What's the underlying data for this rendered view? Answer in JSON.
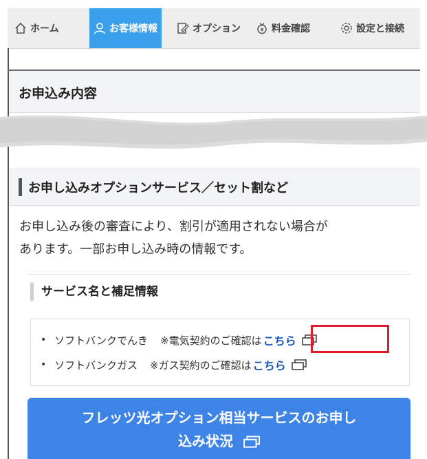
{
  "nav": {
    "items": [
      {
        "label": "ホーム",
        "icon": "home-icon",
        "active": false
      },
      {
        "label": "お客様情報",
        "icon": "user-icon",
        "active": true
      },
      {
        "label": "オプション",
        "icon": "edit-icon",
        "active": false
      },
      {
        "label": "料金確認",
        "icon": "coin-bag-icon",
        "active": false
      },
      {
        "label": "設定と接続",
        "icon": "gear-icon",
        "active": false
      }
    ],
    "active_color": "#3aa0ec"
  },
  "section": {
    "title": "お申込み内容"
  },
  "option_section": {
    "title": "お申し込みオプションサービス／セット割など",
    "note_line1": "お申し込み後の審査により、割引が適用されない場合が",
    "note_line2": "あります。一部お申し込み時の情報です。",
    "services_heading": "サービス名と補足情報",
    "services": [
      {
        "name": "ソフトバンクでんき",
        "note": "※電気契約のご確認は",
        "link": "こちら",
        "external_icon": "external-window-icon"
      },
      {
        "name": "ソフトバンクガス",
        "note": "※ガス契約のご確認は",
        "link": "こちら",
        "external_icon": "external-window-icon"
      }
    ],
    "cta_line1": "フレッツ光オプション相当サービスのお申し",
    "cta_line2": "込み状況"
  },
  "colors": {
    "highlight": "#e6192e",
    "link": "#1a56b8",
    "cta": "#3d84e6"
  }
}
